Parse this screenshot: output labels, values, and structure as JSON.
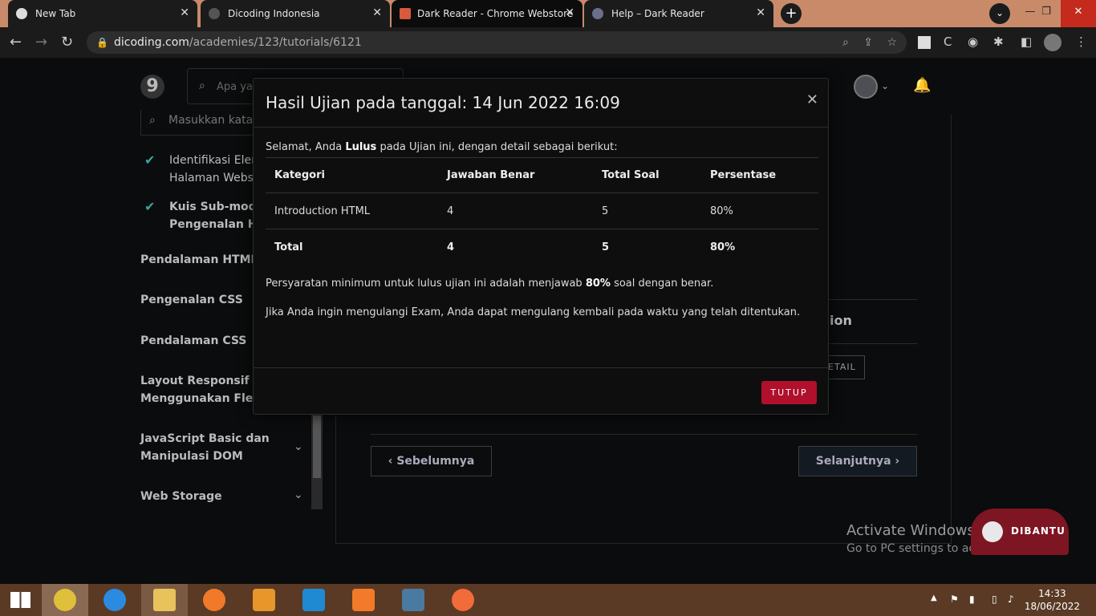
{
  "browser": {
    "tabs": [
      {
        "title": "New Tab"
      },
      {
        "title": "Dicoding Indonesia"
      },
      {
        "title": "Dark Reader - Chrome Webstore"
      },
      {
        "title": "Help – Dark Reader"
      }
    ],
    "url_host": "dicoding.com",
    "url_path": "/academies/123/tutorials/6121"
  },
  "header": {
    "logo": "9",
    "search_placeholder": "Apa ya"
  },
  "sidebar": {
    "search_placeholder": "Masukkan kata",
    "items": [
      {
        "line1": "Identifikasi Elem",
        "line2": "Halaman Webs"
      },
      {
        "line1": "Kuis Sub-modu",
        "line2": "Pengenalan HT"
      },
      {
        "label": "Pendalaman HTML"
      },
      {
        "label": "Pengenalan CSS"
      },
      {
        "label": "Pendalaman CSS"
      },
      {
        "line1": "Layout Responsif",
        "line2": "Menggunakan Flexb"
      },
      {
        "line1": "JavaScript Basic dan",
        "line2": "Manipulasi DOM"
      },
      {
        "label": "Web Storage"
      }
    ]
  },
  "content": {
    "partial_title": "ion",
    "detail_button": "ETAIL",
    "prev_button": "Sebelumnya",
    "next_button": "Selanjutnya"
  },
  "modal": {
    "title": "Hasil Ujian pada tanggal: 14 Jun 2022 16:09",
    "intro_before": "Selamat, Anda ",
    "intro_bold": "Lulus",
    "intro_after": " pada Ujian ini, dengan detail sebagai berikut:",
    "table": {
      "headers": [
        "Kategori",
        "Jawaban Benar",
        "Total Soal",
        "Persentase"
      ],
      "rows": [
        [
          "Introduction HTML",
          "4",
          "5",
          "80%"
        ]
      ],
      "total": [
        "Total",
        "4",
        "5",
        "80%"
      ]
    },
    "requirement_before": "Persyaratan minimum untuk lulus ujian ini adalah menjawab ",
    "requirement_bold": "80%",
    "requirement_after": " soal dengan benar.",
    "retry_text": "Jika Anda ingin mengulangi Exam, Anda dapat mengulang kembali pada waktu yang telah ditentukan.",
    "close_button": "TUTUP"
  },
  "overlay": {
    "activate_title": "Activate Windows",
    "activate_sub": "Go to PC settings to activate Windows.",
    "dibantu": "DIBANTU"
  },
  "taskbar": {
    "time": "14:33",
    "date": "18/06/2022"
  },
  "colors": {
    "accent": "#b0102c",
    "check": "#3aa4a0",
    "tab_bar": "#c98a6a"
  }
}
